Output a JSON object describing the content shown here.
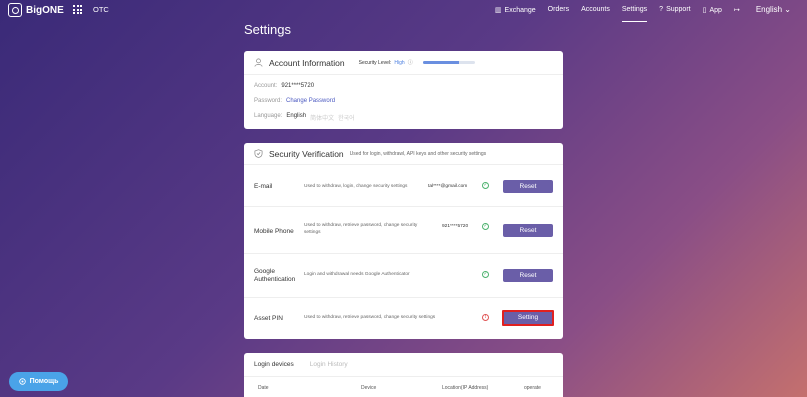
{
  "nav": {
    "brand": "BigONE",
    "otc": "OTC",
    "items": [
      {
        "label": "Exchange",
        "icon": "chart-icon"
      },
      {
        "label": "Orders"
      },
      {
        "label": "Accounts"
      },
      {
        "label": "Settings",
        "active": true
      },
      {
        "label": "Support",
        "icon": "question-icon"
      },
      {
        "label": "App",
        "icon": "phone-icon"
      },
      {
        "label": "",
        "icon": "logout-icon"
      }
    ],
    "language": "English"
  },
  "page_title": "Settings",
  "account": {
    "title": "Account Information",
    "security_level_label": "Security Level:",
    "security_level_value": "High",
    "security_progress": 0.7,
    "account_label": "Account:",
    "account_value": "921****5720",
    "password_label": "Password:",
    "password_link": "Change Password",
    "language_label": "Language:",
    "languages": [
      "English",
      "简体中文",
      "한국어"
    ]
  },
  "security": {
    "title": "Security Verification",
    "subtitle": "Used for login, withdrawl, API keys and other security settings",
    "rows": [
      {
        "name": "E-mail",
        "desc": "Used to withdraw, login, change security settings",
        "value": "tal****@gmail.com",
        "status": "ok",
        "button": "Reset"
      },
      {
        "name": "Mobile Phone",
        "desc": "Used to withdraw, retrieve password, change security settings",
        "value": "921****5720",
        "status": "ok",
        "button": "Reset"
      },
      {
        "name": "Google Authentication",
        "desc": "Login and withdrawal needs Google Authenticator",
        "value": "",
        "status": "ok",
        "button": "Reset"
      },
      {
        "name": "Asset PIN",
        "desc": "Used to withdraw, retrieve password, change security settings",
        "value": "",
        "status": "warn",
        "button": "Setting"
      }
    ]
  },
  "login": {
    "tabs": [
      "Login devices",
      "Login History"
    ],
    "columns": [
      "Date",
      "Device",
      "Location(IP Address)",
      "operate"
    ]
  },
  "help_button": "Помощь"
}
